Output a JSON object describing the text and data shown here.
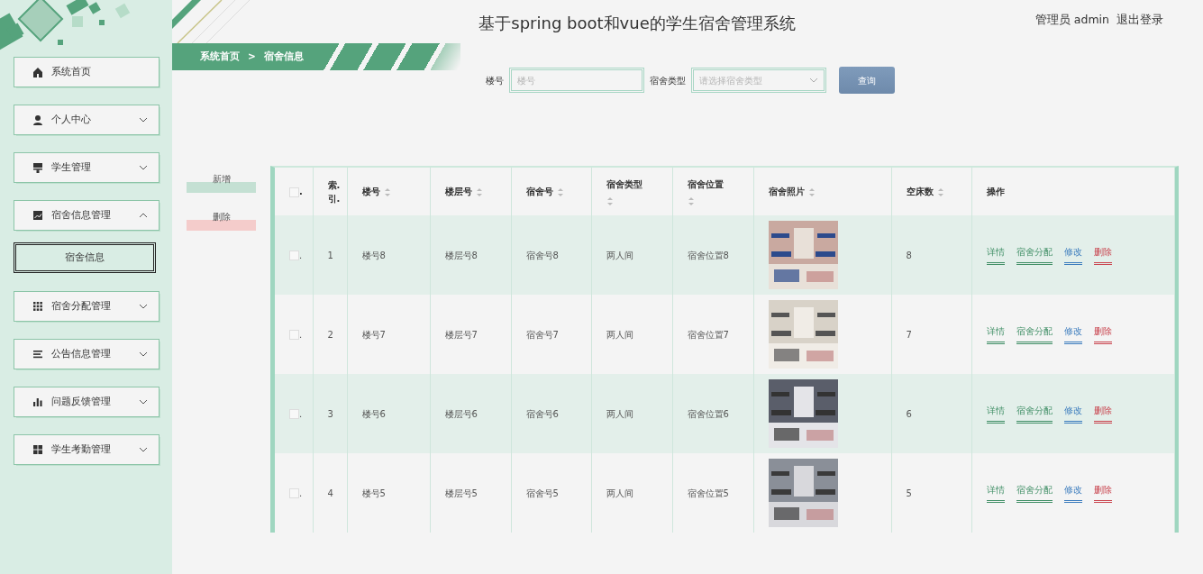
{
  "header": {
    "title": "基于spring boot和vue的学生宿舍管理系统",
    "user": "管理员 admin",
    "logout": "退出登录"
  },
  "breadcrumb": {
    "home": "系统首页",
    "separator": ">",
    "current": "宿舍信息"
  },
  "sidebar": {
    "items": [
      {
        "label": "系统首页",
        "kind": "link"
      },
      {
        "label": "个人中心",
        "kind": "menu",
        "expanded": false
      },
      {
        "label": "学生管理",
        "kind": "menu",
        "expanded": false
      },
      {
        "label": "宿舍信息管理",
        "kind": "menu",
        "expanded": true,
        "children": [
          {
            "label": "宿舍信息",
            "selected": true
          }
        ]
      },
      {
        "label": "宿舍分配管理",
        "kind": "menu",
        "expanded": false
      },
      {
        "label": "公告信息管理",
        "kind": "menu",
        "expanded": false
      },
      {
        "label": "问题反馈管理",
        "kind": "menu",
        "expanded": false
      },
      {
        "label": "学生考勤管理",
        "kind": "menu",
        "expanded": false
      }
    ]
  },
  "search": {
    "fields": [
      {
        "label": "楼号",
        "placeholder": "楼号",
        "kind": "input"
      },
      {
        "label": "宿舍类型",
        "placeholder": "请选择宿舍类型",
        "kind": "select"
      }
    ],
    "button": "查询"
  },
  "actions": [
    {
      "label": "新增",
      "kind": "add"
    },
    {
      "label": "删除",
      "kind": "delete"
    }
  ],
  "table": {
    "columns": [
      {
        "label": ".",
        "kind": "checkbox",
        "checked": false
      },
      {
        "label": "索. 引.",
        "sortable": false
      },
      {
        "label": "楼号",
        "sortable": true
      },
      {
        "label": "楼层号",
        "sortable": true
      },
      {
        "label": "宿舍号",
        "sortable": true
      },
      {
        "label": "宿舍类型",
        "sortable": true,
        "wrap": true
      },
      {
        "label": "宿舍位置",
        "sortable": true,
        "wrap": true
      },
      {
        "label": "宿舍照片",
        "sortable": true
      },
      {
        "label": "空床数",
        "sortable": true
      },
      {
        "label": "操作",
        "sortable": false
      }
    ],
    "rows": [
      {
        "checked": false,
        "cells": [
          ".",
          "1",
          "楼号8",
          "楼层号8",
          "宿舍号8",
          "两人间",
          "宿舍位置8",
          "",
          "8"
        ],
        "photo": {
          "kind": "picture"
        },
        "ops": [
          {
            "label": "详情",
            "kind": "detail"
          },
          {
            "label": "宿舍分配",
            "kind": "assign"
          },
          {
            "label": "修改",
            "kind": "edit"
          },
          {
            "label": "删除",
            "kind": "delete"
          }
        ]
      },
      {
        "checked": false,
        "cells": [
          ".",
          "2",
          "楼号7",
          "楼层号7",
          "宿舍号7",
          "两人间",
          "宿舍位置7",
          "",
          "7"
        ],
        "photo": {
          "kind": "picture"
        },
        "ops": [
          {
            "label": "详情",
            "kind": "detail"
          },
          {
            "label": "宿舍分配",
            "kind": "assign"
          },
          {
            "label": "修改",
            "kind": "edit"
          },
          {
            "label": "删除",
            "kind": "delete"
          }
        ]
      },
      {
        "checked": false,
        "cells": [
          ".",
          "3",
          "楼号6",
          "楼层号6",
          "宿舍号6",
          "两人间",
          "宿舍位置6",
          "",
          "6"
        ],
        "photo": {
          "kind": "picture"
        },
        "ops": [
          {
            "label": "详情",
            "kind": "detail"
          },
          {
            "label": "宿舍分配",
            "kind": "assign"
          },
          {
            "label": "修改",
            "kind": "edit"
          },
          {
            "label": "删除",
            "kind": "delete"
          }
        ]
      },
      {
        "checked": false,
        "cells": [
          ".",
          "4",
          "楼号5",
          "楼层号5",
          "宿舍号5",
          "两人间",
          "宿舍位置5",
          "",
          "5"
        ],
        "photo": {
          "kind": "picture"
        },
        "ops": [
          {
            "label": "详情",
            "kind": "detail"
          },
          {
            "label": "宿舍分配",
            "kind": "assign"
          },
          {
            "label": "修改",
            "kind": "edit"
          },
          {
            "label": "删除",
            "kind": "delete"
          }
        ]
      }
    ]
  }
}
